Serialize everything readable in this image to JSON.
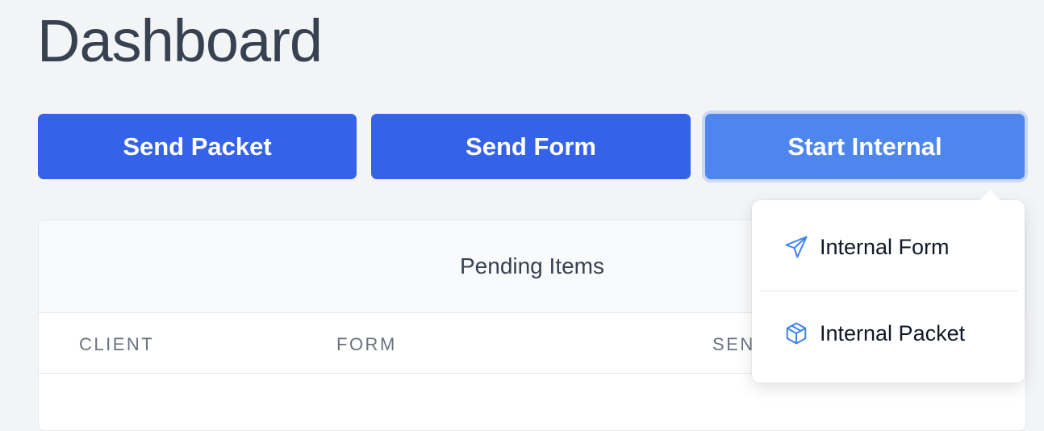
{
  "page": {
    "title": "Dashboard"
  },
  "actions": {
    "send_packet": "Send Packet",
    "send_form": "Send Form",
    "start_internal": "Start Internal"
  },
  "pending": {
    "title": "Pending Items",
    "columns": [
      "CLIENT",
      "FORM",
      "SEN"
    ]
  },
  "dropdown": {
    "items": [
      {
        "label": "Internal Form",
        "icon": "paper-plane-icon"
      },
      {
        "label": "Internal Packet",
        "icon": "package-box-icon"
      }
    ]
  },
  "colors": {
    "primary": "#3463ea",
    "primary_active": "#4f86ee",
    "icon": "#3b82f6"
  }
}
